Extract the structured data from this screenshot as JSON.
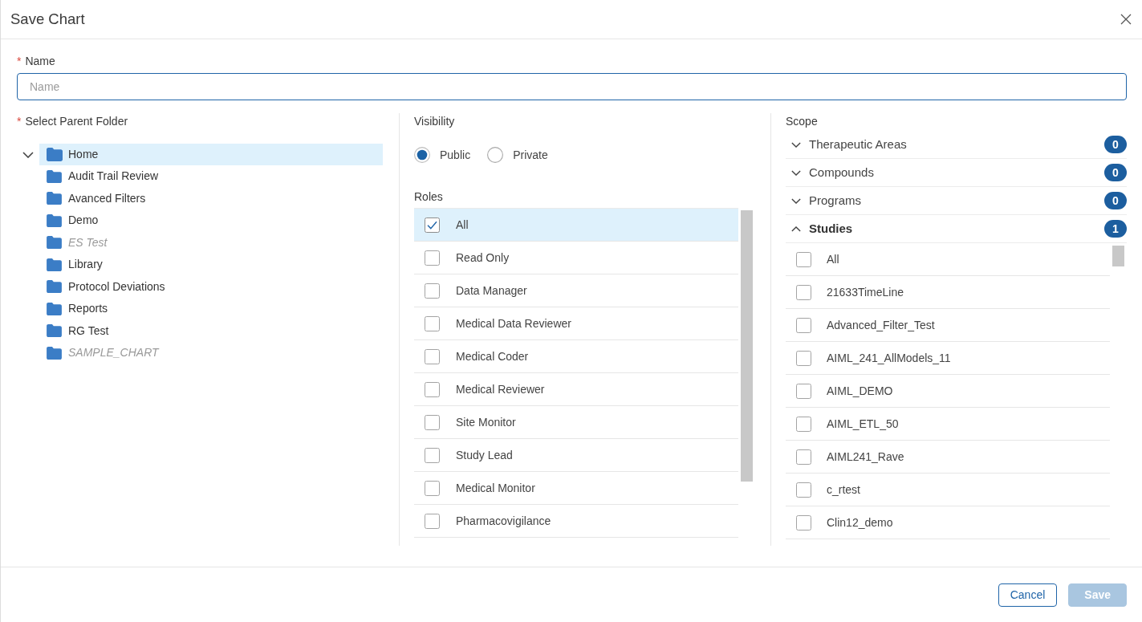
{
  "dialog": {
    "title": "Save Chart"
  },
  "name_field": {
    "required_mark": "*",
    "label": "Name",
    "placeholder": "Name"
  },
  "parent_folder": {
    "required_mark": "*",
    "label": "Select Parent Folder",
    "tree": [
      {
        "label": "Home",
        "expanded": true,
        "selected": true,
        "children": [
          {
            "label": "Audit Trail Review",
            "selected": false,
            "disabled": false
          },
          {
            "label": "Avanced Filters",
            "selected": false,
            "disabled": false
          },
          {
            "label": "Demo",
            "selected": false,
            "disabled": false
          },
          {
            "label": "ES Test",
            "selected": false,
            "disabled": true
          },
          {
            "label": "Library",
            "selected": false,
            "disabled": false
          },
          {
            "label": "Protocol Deviations",
            "selected": false,
            "disabled": false
          },
          {
            "label": "Reports",
            "selected": false,
            "disabled": false
          },
          {
            "label": "RG Test",
            "selected": false,
            "disabled": false
          },
          {
            "label": "SAMPLE_CHART",
            "selected": false,
            "disabled": true
          }
        ]
      }
    ]
  },
  "visibility": {
    "label": "Visibility",
    "options": [
      {
        "label": "Public",
        "selected": true
      },
      {
        "label": "Private",
        "selected": false
      }
    ]
  },
  "roles": {
    "label": "Roles",
    "items": [
      {
        "label": "All",
        "checked": true,
        "selected": true
      },
      {
        "label": "Read Only",
        "checked": false,
        "selected": false
      },
      {
        "label": "Data Manager",
        "checked": false,
        "selected": false
      },
      {
        "label": "Medical Data Reviewer",
        "checked": false,
        "selected": false
      },
      {
        "label": "Medical Coder",
        "checked": false,
        "selected": false
      },
      {
        "label": "Medical Reviewer",
        "checked": false,
        "selected": false
      },
      {
        "label": "Site Monitor",
        "checked": false,
        "selected": false
      },
      {
        "label": "Study Lead",
        "checked": false,
        "selected": false
      },
      {
        "label": "Medical Monitor",
        "checked": false,
        "selected": false
      },
      {
        "label": "Pharmacovigilance",
        "checked": false,
        "selected": false
      }
    ]
  },
  "scope": {
    "label": "Scope",
    "sections": [
      {
        "label": "Therapeutic Areas",
        "expanded": false,
        "count": "0"
      },
      {
        "label": "Compounds",
        "expanded": false,
        "count": "0"
      },
      {
        "label": "Programs",
        "expanded": false,
        "count": "0"
      },
      {
        "label": "Studies",
        "expanded": true,
        "count": "1",
        "items": [
          {
            "label": "All",
            "checked": false
          },
          {
            "label": "21633TimeLine",
            "checked": false
          },
          {
            "label": "Advanced_Filter_Test",
            "checked": false
          },
          {
            "label": "AIML_241_AllModels_11",
            "checked": false
          },
          {
            "label": "AIML_DEMO",
            "checked": false
          },
          {
            "label": "AIML_ETL_50",
            "checked": false
          },
          {
            "label": "AIML241_Rave",
            "checked": false
          },
          {
            "label": "c_rtest",
            "checked": false
          },
          {
            "label": "Clin12_demo",
            "checked": false
          }
        ]
      }
    ]
  },
  "buttons": [
    {
      "label": "Cancel",
      "kind": "outline",
      "disabled": false
    },
    {
      "label": "Save",
      "kind": "primary",
      "disabled": true
    }
  ]
}
